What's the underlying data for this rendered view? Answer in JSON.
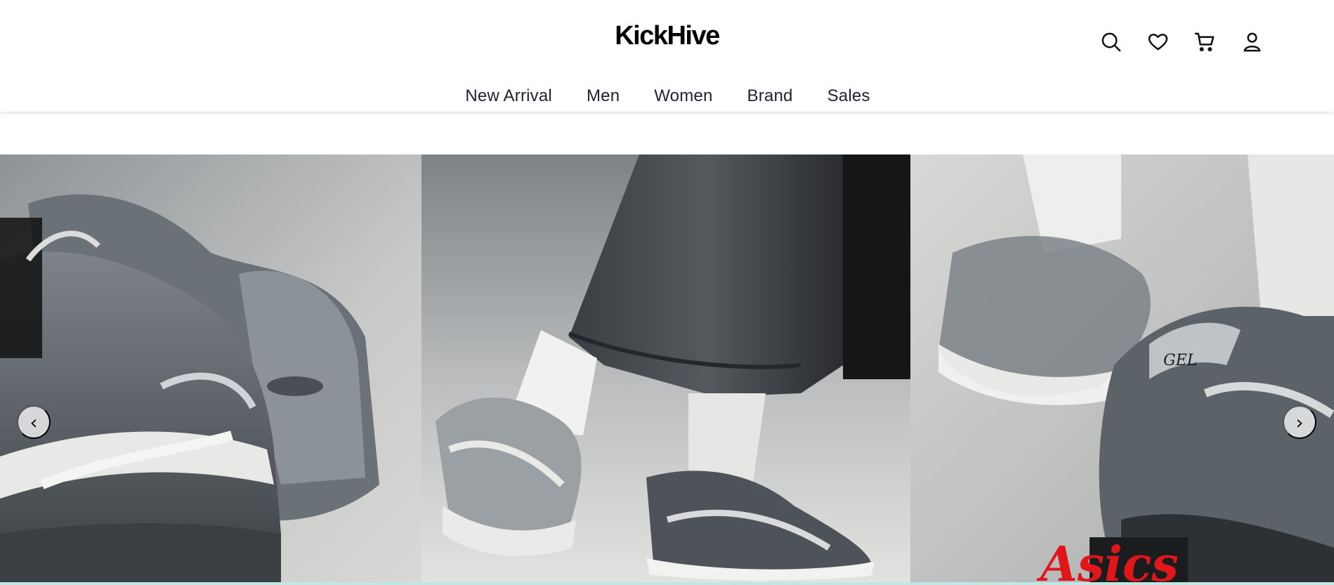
{
  "header": {
    "logo": "KickHive",
    "icons": [
      "search-icon",
      "heart-icon",
      "cart-icon",
      "user-icon"
    ]
  },
  "nav": {
    "items": [
      {
        "label": "New Arrival"
      },
      {
        "label": "Men"
      },
      {
        "label": "Women"
      },
      {
        "label": "Brand"
      },
      {
        "label": "Sales"
      }
    ]
  },
  "hero": {
    "prev_label": "‹",
    "next_label": "›",
    "slides": [
      {
        "alt": "Close-up of grey GEL-KAYANO sneakers"
      },
      {
        "alt": "Person in denim wearing silver running shoes and white socks"
      },
      {
        "alt": "Blurred close-up of grey GEL sneaker with white sock"
      }
    ],
    "brand_script": "Asics"
  },
  "colors": {
    "text": "#1f2330",
    "logo": "#000000",
    "accent_strip": "#bfe8e4",
    "brand_script": "#e0161b"
  }
}
